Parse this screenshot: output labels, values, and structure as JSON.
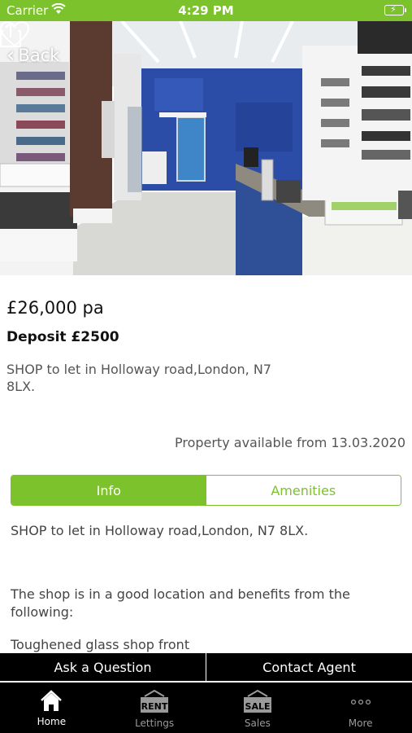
{
  "status_bar": {
    "carrier": "Carrier",
    "time": "4:29 PM",
    "battery_icon": "battery-charging-icon"
  },
  "nav": {
    "back_label": "Back",
    "share_icon": "share-icon",
    "favorite_icon": "heart-icon"
  },
  "listing": {
    "price": "£26,000 pa",
    "deposit": "Deposit £2500",
    "summary": "SHOP to let in Holloway road,London, N7 8LX.",
    "availability": "Property available from 13.03.2020"
  },
  "tabs": [
    {
      "label": "Info",
      "active": true
    },
    {
      "label": "Amenities",
      "active": false
    }
  ],
  "details": {
    "line1": "SHOP to let  in Holloway road,London, N7 8LX.",
    "line2": "The shop is in a good location and benefits from the following:",
    "line3": "Toughened glass shop front"
  },
  "actions": {
    "ask": "Ask a Question",
    "contact": "Contact Agent"
  },
  "tabbar": [
    {
      "label": "Home",
      "icon": "home-icon",
      "active": true
    },
    {
      "label": "Lettings",
      "icon": "rent-sign-icon",
      "active": false,
      "sign_text": "RENT"
    },
    {
      "label": "Sales",
      "icon": "sale-sign-icon",
      "active": false,
      "sign_text": "SALE"
    },
    {
      "label": "More",
      "icon": "more-dots-icon",
      "active": false
    }
  ],
  "colors": {
    "accent": "#7cc22d",
    "bar": "#000000"
  }
}
